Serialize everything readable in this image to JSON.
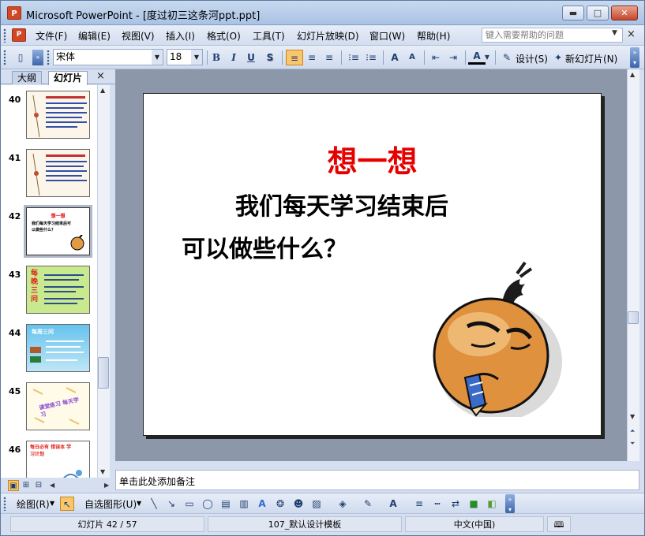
{
  "window": {
    "title": "Microsoft PowerPoint - [度过初三这条河ppt.ppt]",
    "app_badge": "P",
    "minimize": "▬",
    "maximize": "□",
    "close": "✕"
  },
  "menu": {
    "items": [
      "文件(F)",
      "编辑(E)",
      "视图(V)",
      "插入(I)",
      "格式(O)",
      "工具(T)",
      "幻灯片放映(D)",
      "窗口(W)",
      "帮助(H)"
    ],
    "help_placeholder": "键入需要帮助的问题",
    "doc_close": "×"
  },
  "toolbar": {
    "font_name": "宋体",
    "font_size": "18",
    "bold": "B",
    "italic": "I",
    "underline": "U",
    "shadow": "S",
    "design_label": "设计(S)",
    "new_slide_label": "新幻灯片(N)",
    "grow_font": "A",
    "shrink_font": "A",
    "font_color": "A"
  },
  "left_panel": {
    "tabs": [
      "大纲",
      "幻灯片"
    ],
    "close": "×",
    "slides": [
      {
        "number": "40",
        "selected": false
      },
      {
        "number": "41",
        "selected": false
      },
      {
        "number": "42",
        "selected": true
      },
      {
        "number": "43",
        "selected": false
      },
      {
        "number": "44",
        "selected": false
      },
      {
        "number": "45",
        "selected": false
      },
      {
        "number": "46",
        "selected": false
      }
    ],
    "thumb_texts": {
      "t42_title": "想一想",
      "t42_body": "我们每天学习结束后可以做些什么？",
      "t43_vertical": "每晚三问",
      "t44_title": "每周三问",
      "t45_text": "课堂练习 每天学习",
      "t46_text": "每日必有 错误本 学习计划"
    }
  },
  "slide": {
    "title": "想一想",
    "line1": "我们每天学习结束后",
    "line2": "可以做些什么？",
    "title_color": "#e60000"
  },
  "notes": {
    "placeholder": "单击此处添加备注"
  },
  "draw_toolbar": {
    "draw_label": "绘图(R)",
    "autoshapes_label": "自选图形(U)"
  },
  "status": {
    "slide_pos": "幻灯片 42 / 57",
    "template": "107_默认设计模板",
    "language": "中文(中国)"
  }
}
